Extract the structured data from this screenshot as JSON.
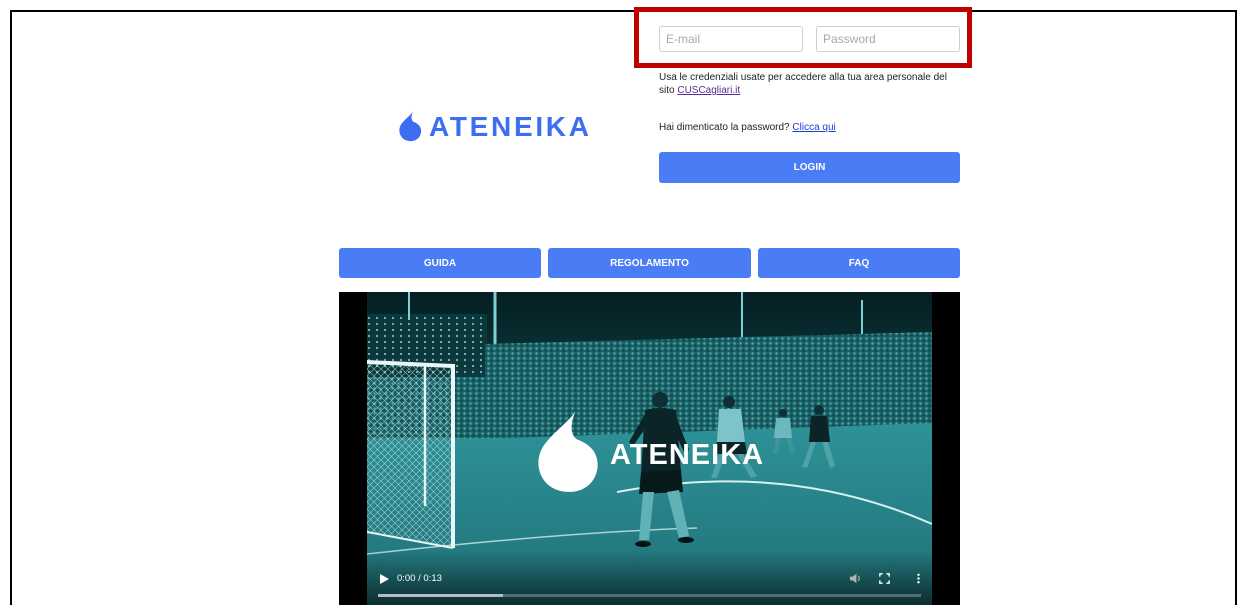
{
  "colors": {
    "accent": "#4a7cf6",
    "logo": "#3d6df0",
    "highlight": "#c00000",
    "link": "#1a3fd6",
    "link_visited": "#5b2d8f"
  },
  "login": {
    "email_placeholder": "E-mail",
    "password_placeholder": "Password",
    "credentials_note": "Usa le credenziali usate per accedere alla tua area personale del sito",
    "credentials_link": "CUSCagliari.it",
    "forgot_text": "Hai dimenticato la password?",
    "forgot_link": "Clicca qui",
    "login_label": "LOGIN"
  },
  "logo": {
    "text": "ATENEIKA",
    "icon": "flame-drop-icon"
  },
  "nav": {
    "buttons": [
      {
        "label": "GUIDA"
      },
      {
        "label": "REGOLAMENTO"
      },
      {
        "label": "FAQ"
      }
    ]
  },
  "video": {
    "overlay_logo_text": "ATENEIKA",
    "time_display": "0:00 / 0:13",
    "buffered_fraction": 0.23,
    "icons": {
      "play": "play-icon",
      "volume": "volume-icon",
      "fullscreen": "fullscreen-icon",
      "more": "more-options-icon"
    }
  }
}
